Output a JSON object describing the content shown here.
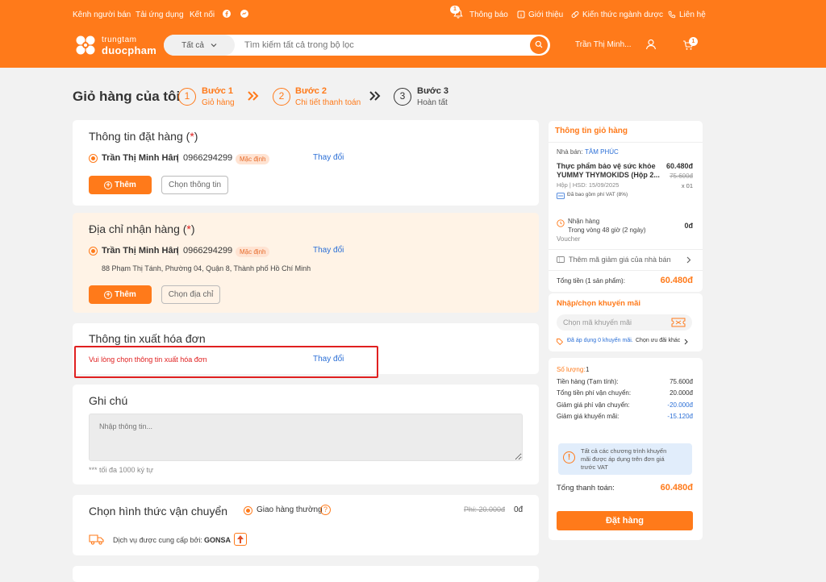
{
  "topbar": {
    "seller_channel": "Kênh người bán",
    "download_app": "Tải ứng dụng",
    "connect": "Kết nối",
    "notification": "Thông báo",
    "notification_count": "1",
    "intro": "Giới thiệu",
    "knowledge": "Kiến thức ngành dược",
    "contact": "Liên hệ"
  },
  "header": {
    "logo_top": "trungtam",
    "logo_bottom": "duocpham",
    "category": "Tất cả",
    "search_placeholder": "Tìm kiếm tất cả trong bộ lọc",
    "user": "Trần Thị Minh...",
    "cart_count": "1"
  },
  "steps": {
    "page_title": "Giỏ hàng của tôi",
    "items": [
      {
        "num": "1",
        "title": "Bước 1",
        "sub": "Giỏ hàng"
      },
      {
        "num": "2",
        "title": "Bước 2",
        "sub": "Chi tiết thanh toán"
      },
      {
        "num": "3",
        "title": "Bước 3",
        "sub": "Hoàn tất"
      }
    ]
  },
  "order_info": {
    "title": "Thông tin đặt hàng (",
    "req": "*",
    "close": ")",
    "name": "Trần Thị Minh Hân",
    "sep": "|",
    "phone": "0966294299",
    "badge": "Mặc định",
    "change": "Thay đổi",
    "add": "Thêm",
    "choose": "Chọn thông tin"
  },
  "address": {
    "title": "Địa chỉ nhận hàng (",
    "req": "*",
    "close": ")",
    "name": "Trần Thị Minh Hân",
    "sep": "|",
    "phone": "0966294299",
    "badge": "Mặc định",
    "change": "Thay đổi",
    "addr": "88 Phạm Thị Tánh, Phường 04, Quận 8, Thành phố Hồ Chí Minh",
    "add": "Thêm",
    "choose": "Chọn địa chỉ"
  },
  "invoice": {
    "title": "Thông tin xuất hóa đơn",
    "warning": "Vui lòng chọn thông tin xuất hóa đơn",
    "change": "Thay đổi"
  },
  "note": {
    "title": "Ghi chú",
    "placeholder": "Nhập thông tin...",
    "limit": "*** tối đa 1000 ký tự"
  },
  "shipping": {
    "title": "Chọn hình thức vận chuyển",
    "option": "Giao hàng thường",
    "old_fee": "Phí: 20.000đ",
    "fee": "0đ",
    "provider_label": "Dịch vụ được cung cấp bởi:",
    "provider": "GONSA"
  },
  "cart": {
    "title": "Thông tin giỏ hàng",
    "seller_label": "Nhà bán:",
    "seller": "TÂM PHÚC",
    "product_name_1": "Thực phẩm bảo vệ sức khỏe",
    "product_name_2": "YUMMY THYMOKIDS (Hộp 2...",
    "price": "60.480đ",
    "old_price": "75.600đ",
    "meta": "Hộp | HSD: 15/09/2025",
    "qty": "x 01",
    "vat": "Đã bao gồm phí VAT (8%)",
    "delivery_title": "Nhận hàng",
    "delivery_time": "Trong vòng 48 giờ (2 ngày)",
    "delivery_fee": "0đ",
    "voucher": "Voucher",
    "seller_voucher": "Thêm mã giảm giá của nhà bán",
    "subtotal_label": "Tổng tiền (1 sản phẩm):",
    "subtotal": "60.480đ"
  },
  "promo": {
    "title": "Nhập/chọn khuyến mãi",
    "placeholder": "Chọn mã khuyến mãi",
    "applied": "Đã áp dụng 0 khuyến mãi.",
    "choose_more": "Chọn ưu đãi khác"
  },
  "summary": {
    "qty_label": "Số lượng:",
    "qty": "1",
    "rows": [
      {
        "label": "Tiền hàng (Tạm tính):",
        "value": "75.600đ"
      },
      {
        "label": "Tổng tiền phí vận chuyển:",
        "value": "20.000đ"
      },
      {
        "label": "Giảm giá phí vận chuyển:",
        "value": "-20.000đ"
      },
      {
        "label": "Giảm giá khuyến mãi:",
        "value": "-15.120đ"
      }
    ],
    "notice": "Tất cả các chương trình khuyến mãi được áp dụng trên đơn giá trước VAT",
    "total_label": "Tổng thanh toán:",
    "total": "60.480đ",
    "order_button": "Đặt hàng"
  },
  "colors": {
    "brand": "#ff7a1a",
    "link": "#2b6fd6",
    "error": "#e02020"
  }
}
